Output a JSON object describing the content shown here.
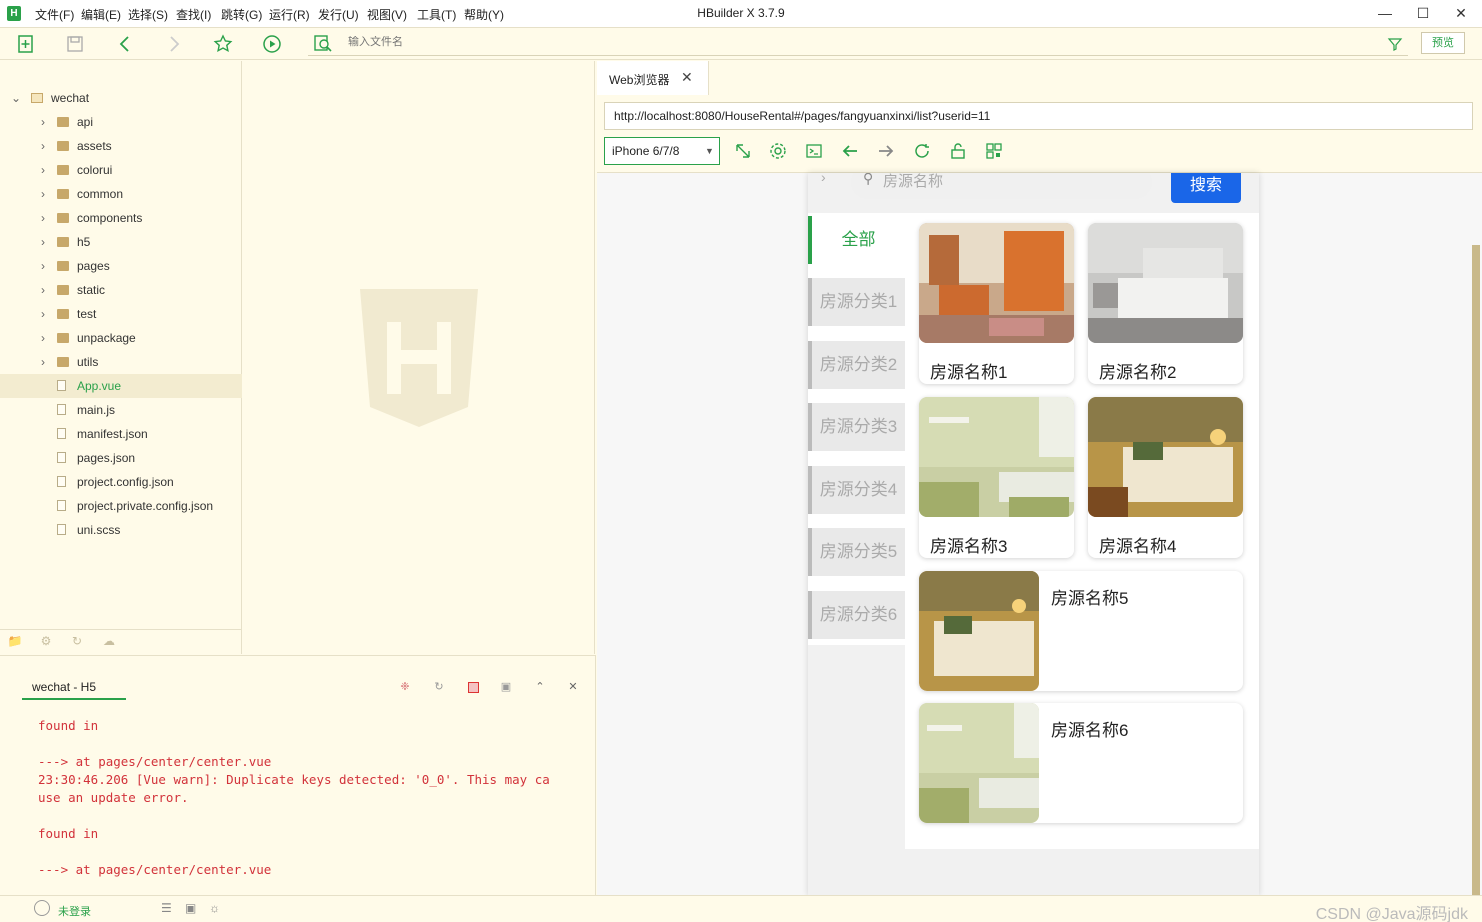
{
  "window": {
    "app_logo": "H",
    "title": "HBuilder X 3.7.9",
    "menu": [
      "文件(F)",
      "编辑(E)",
      "选择(S)",
      "查找(I)",
      "跳转(G)",
      "运行(R)",
      "发行(U)",
      "视图(V)",
      "工具(T)",
      "帮助(Y)"
    ]
  },
  "toolbar": {
    "file_search_placeholder": "输入文件名",
    "preview_label": "预览"
  },
  "sidebar": {
    "project": "wechat",
    "items": [
      {
        "label": "api",
        "type": "folder"
      },
      {
        "label": "assets",
        "type": "folder"
      },
      {
        "label": "colorui",
        "type": "folder"
      },
      {
        "label": "common",
        "type": "folder"
      },
      {
        "label": "components",
        "type": "folder"
      },
      {
        "label": "h5",
        "type": "folder"
      },
      {
        "label": "pages",
        "type": "folder"
      },
      {
        "label": "static",
        "type": "folder"
      },
      {
        "label": "test",
        "type": "folder"
      },
      {
        "label": "unpackage",
        "type": "folder"
      },
      {
        "label": "utils",
        "type": "folder"
      },
      {
        "label": "App.vue",
        "type": "file"
      },
      {
        "label": "main.js",
        "type": "file"
      },
      {
        "label": "manifest.json",
        "type": "file"
      },
      {
        "label": "pages.json",
        "type": "file"
      },
      {
        "label": "project.config.json",
        "type": "file"
      },
      {
        "label": "project.private.config.json",
        "type": "file"
      },
      {
        "label": "uni.scss",
        "type": "file"
      }
    ],
    "selected": "App.vue",
    "selected_color": "#2aa14a"
  },
  "console": {
    "tab_label": "wechat - H5",
    "lines": [
      "found in",
      "",
      "---> at pages/center/center.vue",
      "23:30:46.206 [Vue warn]: Duplicate keys detected: '0_0'. This may ca",
      "use an update error.",
      "",
      "found in",
      "",
      "---> at pages/center/center.vue"
    ],
    "text_color": "#d2323a"
  },
  "browser": {
    "tab_label": "Web浏览器",
    "url": "http://localhost:8080/HouseRental#/pages/fangyuanxinxi/list?userid=11",
    "device": "iPhone 6/7/8",
    "app": {
      "search_placeholder": "房源名称",
      "search_button": "搜索",
      "categories": [
        "全部",
        "房源分类1",
        "房源分类2",
        "房源分类3",
        "房源分类4",
        "房源分类5",
        "房源分类6"
      ],
      "active_category": "全部",
      "listings": [
        "房源名称1",
        "房源名称2",
        "房源名称3",
        "房源名称4",
        "房源名称5",
        "房源名称6"
      ]
    }
  },
  "statusbar": {
    "login": "未登录",
    "watermark": "CSDN @Java源码jdk"
  },
  "colors": {
    "accent_green": "#2aa14a",
    "search_blue": "#1a66e8",
    "ide_background": "#fffbe9"
  }
}
